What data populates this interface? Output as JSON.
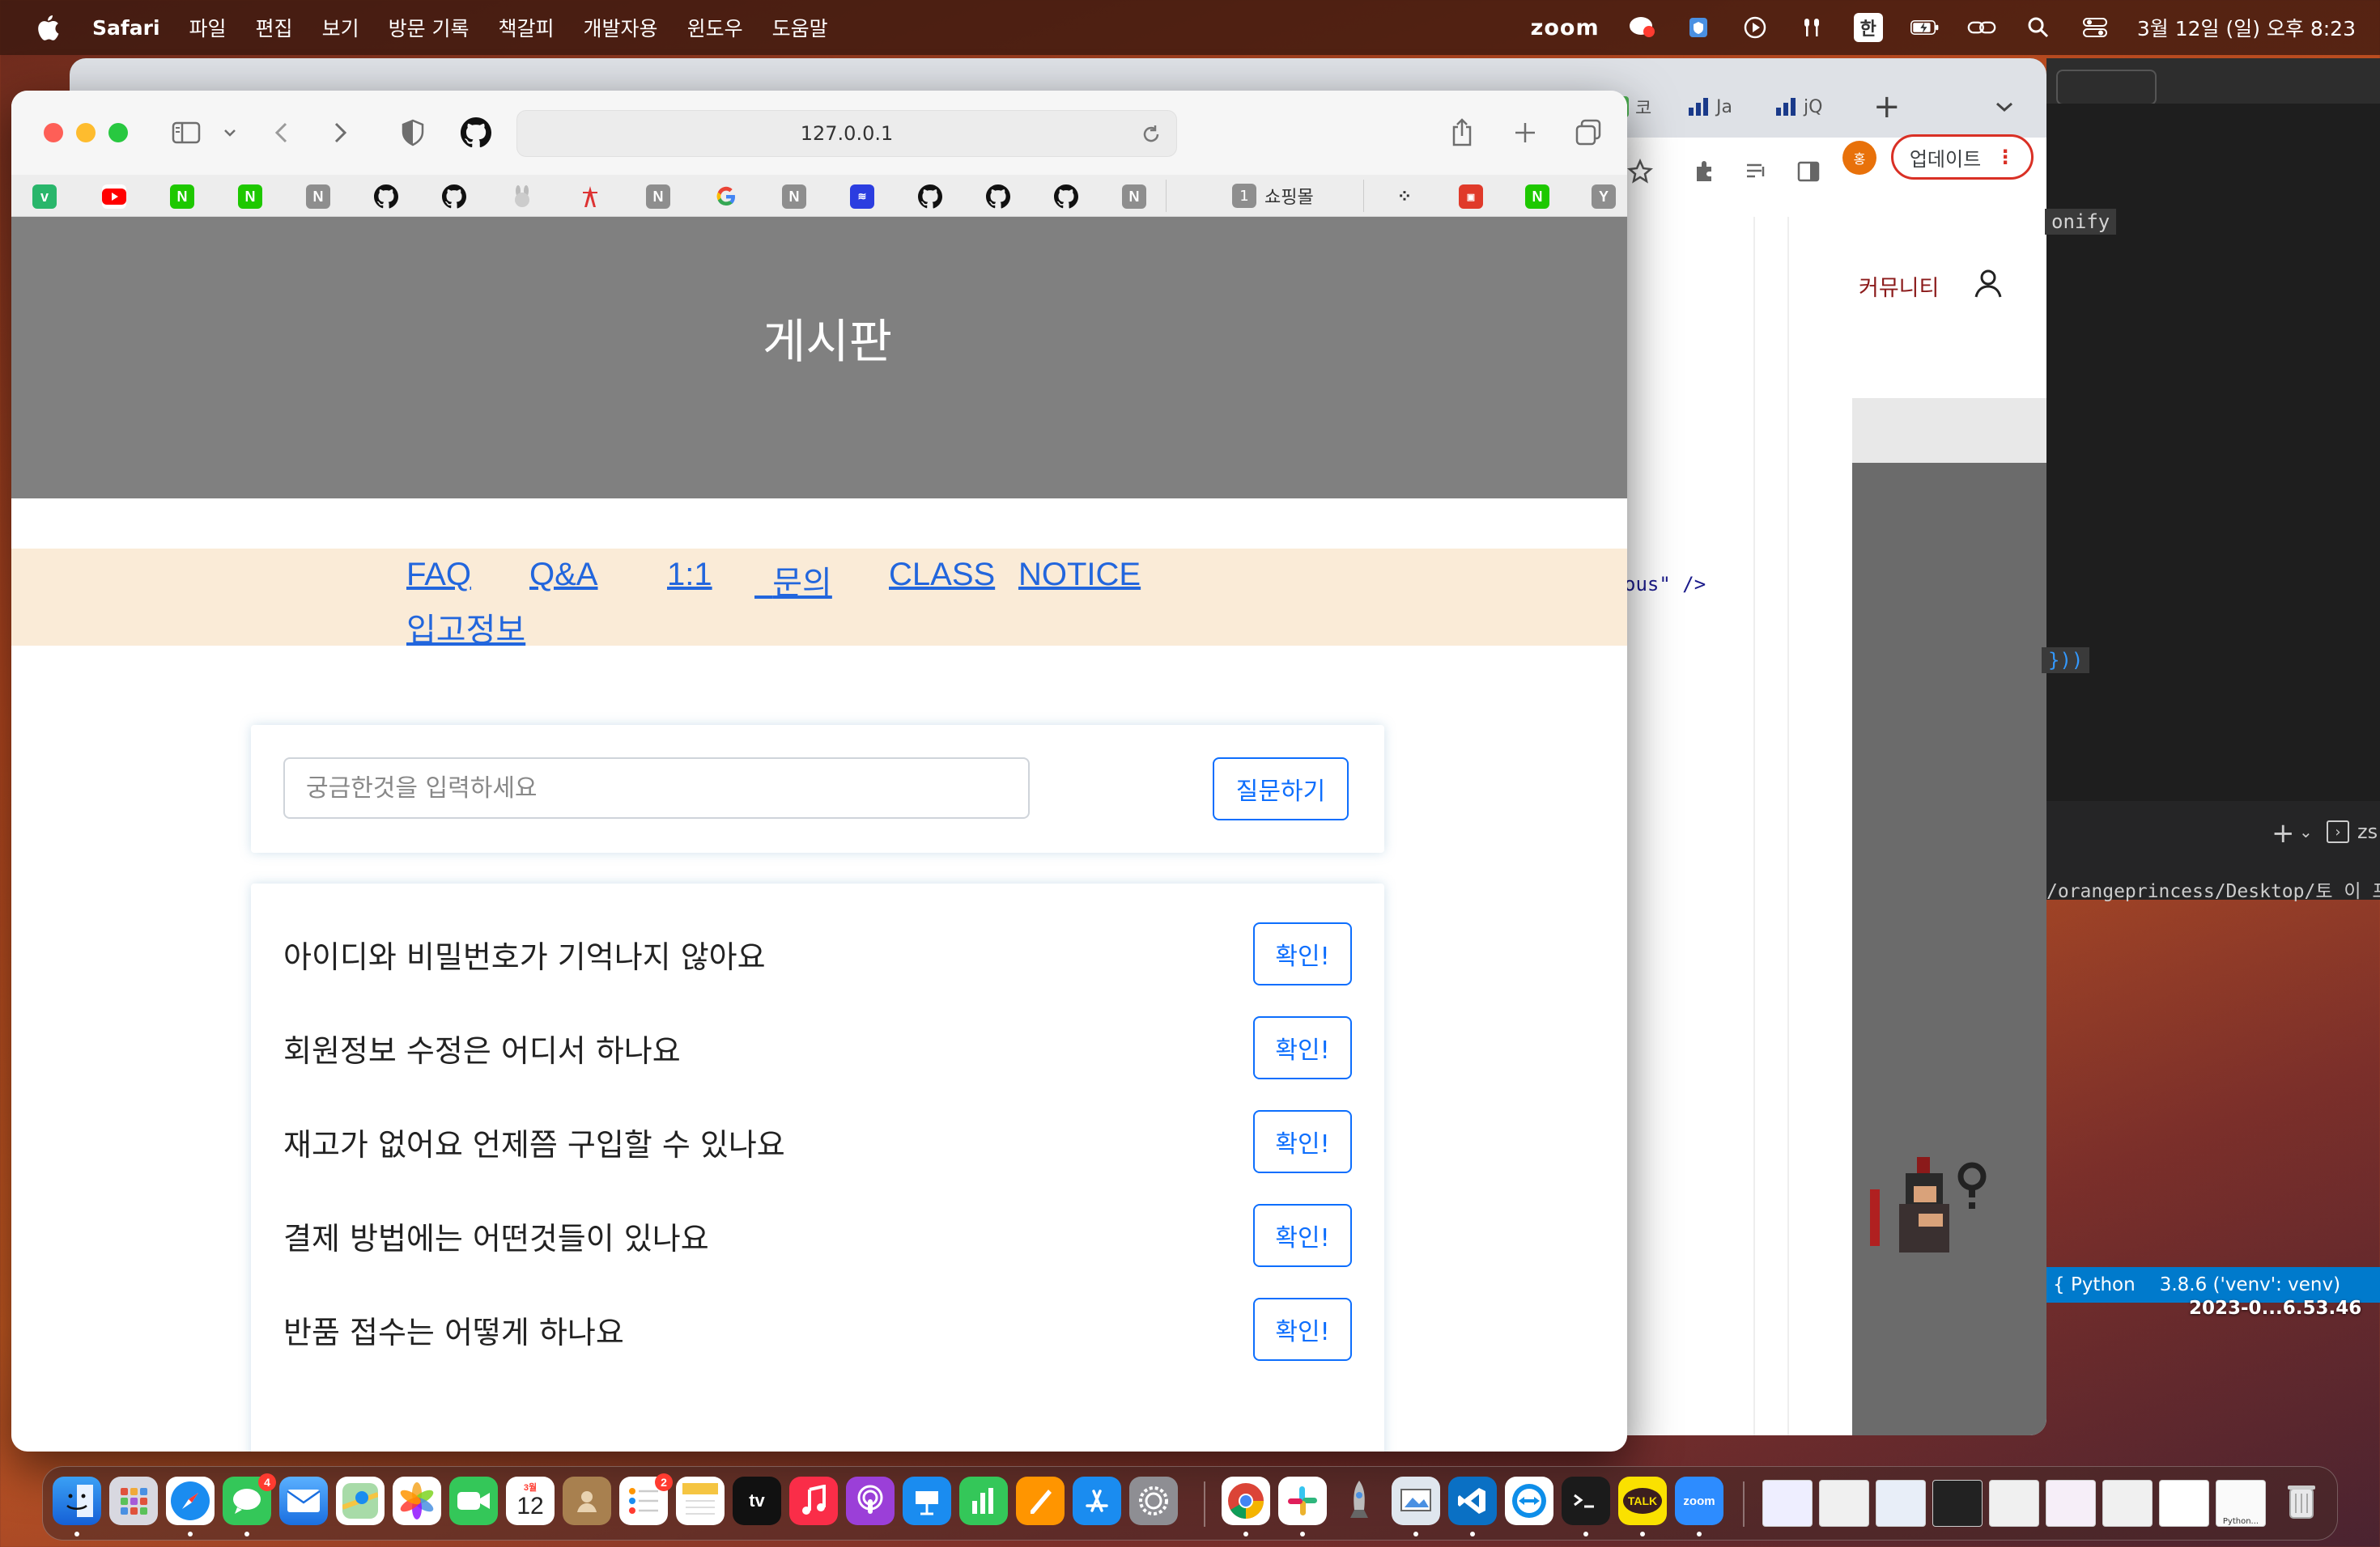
{
  "menubar": {
    "app_name": "Safari",
    "menus": [
      "파일",
      "편집",
      "보기",
      "방문 기록",
      "책갈피",
      "개발자용",
      "윈도우",
      "도움말"
    ],
    "zoom_label": "zoom",
    "input_source": "한",
    "clock": "3월 12일 (일) 오후 8:23"
  },
  "chrome": {
    "tabs": [
      "코",
      "Ja",
      "jQ"
    ],
    "update_label": "업데이트",
    "avatar_letter": "홍",
    "site_nav_label": "커뮤니티"
  },
  "background_code": {
    "chip_top": "onify",
    "snippet_mid": "ous\" />",
    "chip_bottom": "}))",
    "terminal_path": "/orangeprincess/Desktop/토 이 프",
    "terminal_shell": "zs"
  },
  "statusbar": {
    "language": "Python",
    "interpreter": "3.8.6 ('venv': venv)"
  },
  "desktop": {
    "file_label": "2023-0...6.53.46"
  },
  "safari": {
    "url": "127.0.0.1",
    "favorites_folder_count": "1",
    "favorites_folder_label": "쇼핑몰"
  },
  "page": {
    "hero_title": "게시판",
    "nav_links": [
      "FAQ",
      "Q&A",
      "1:1",
      "문의",
      "CLASS",
      "NOTICE",
      "입고정보"
    ],
    "ask": {
      "placeholder": "궁금한것을 입력하세요",
      "button_label": "질문하기"
    },
    "questions": [
      {
        "text": "아이디와 비밀번호가 기억나지 않아요",
        "button": "확인!"
      },
      {
        "text": "회원정보 수정은 어디서 하나요",
        "button": "확인!"
      },
      {
        "text": "재고가 없어요 언제쯤 구입할 수 있나요",
        "button": "확인!"
      },
      {
        "text": "결제 방법에는 어떤것들이 있나요",
        "button": "확인!"
      },
      {
        "text": "반품 접수는 어떻게 하나요",
        "button": "확인!"
      }
    ]
  },
  "dock": {
    "messages_badge": "4",
    "calendar_month": "3월",
    "calendar_day": "12",
    "reminders_badge": "2",
    "tv_label": "tv",
    "talk_label": "TALK",
    "zoom_label": "zoom",
    "thumb_label": "Python..."
  },
  "colors": {
    "link": "#2266dd",
    "primary": "#0d6efd",
    "nav_bg": "#faebd7",
    "hero_bg": "#808080"
  }
}
